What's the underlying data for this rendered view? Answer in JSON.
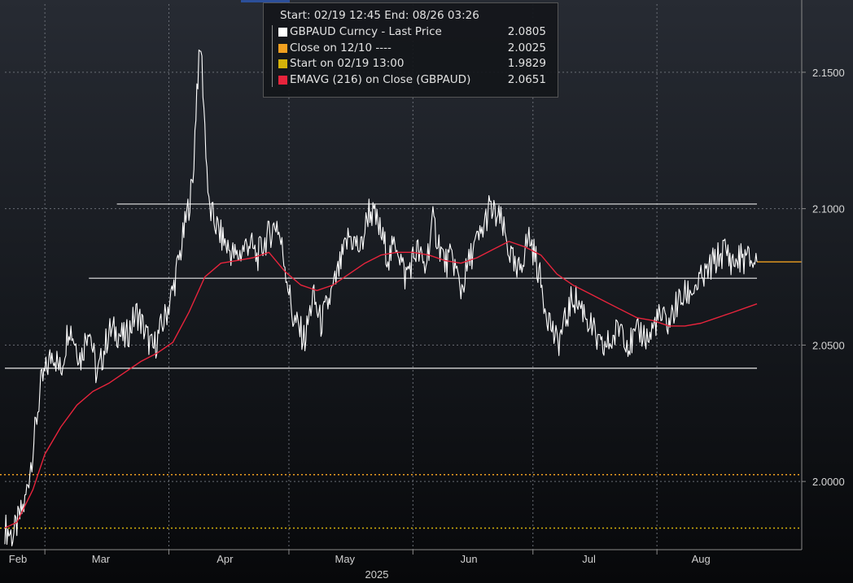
{
  "chart_data": {
    "type": "line",
    "legend": {
      "header": "Start: 02/19 12:45 End: 08/26 03:26",
      "placement": "top-center",
      "entries": [
        {
          "label": "GBPAUD Curncy - Last Price",
          "value": "2.0805",
          "color": "#ffffff"
        },
        {
          "label": "Close on 12/10 ----",
          "value": "2.0025",
          "color": "#f0a020"
        },
        {
          "label": "Start on 02/19 13:00",
          "value": "1.9829",
          "color": "#d4b20a"
        },
        {
          "label": "EMAVG (216)  on Close (GBPAUD)",
          "value": "2.0651",
          "color": "#e8243c"
        }
      ]
    },
    "y_ticks": [
      "2.0000",
      "2.0500",
      "2.1000",
      "2.1500"
    ],
    "ylim": [
      1.975,
      2.175
    ],
    "grid": true,
    "months": [
      "Feb",
      "Mar",
      "Apr",
      "May",
      "Jun",
      "Jul",
      "Aug"
    ],
    "year_label": "2025",
    "x_range": [
      "2025-02-19",
      "2025-08-26"
    ],
    "series": [
      {
        "name": "GBPAUD Curncy - Last Price",
        "color": "#ffffff",
        "x": [
          "2025-02-19",
          "2025-02-21",
          "2025-02-24",
          "2025-02-26",
          "2025-02-28",
          "2025-03-03",
          "2025-03-05",
          "2025-03-07",
          "2025-03-10",
          "2025-03-12",
          "2025-03-14",
          "2025-03-17",
          "2025-03-19",
          "2025-03-21",
          "2025-03-24",
          "2025-03-26",
          "2025-03-28",
          "2025-03-31",
          "2025-04-02",
          "2025-04-04",
          "2025-04-07",
          "2025-04-08",
          "2025-04-09",
          "2025-04-10",
          "2025-04-11",
          "2025-04-14",
          "2025-04-16",
          "2025-04-18",
          "2025-04-21",
          "2025-04-23",
          "2025-04-25",
          "2025-04-28",
          "2025-04-30",
          "2025-05-02",
          "2025-05-05",
          "2025-05-07",
          "2025-05-09",
          "2025-05-12",
          "2025-05-14",
          "2025-05-16",
          "2025-05-19",
          "2025-05-21",
          "2025-05-23",
          "2025-05-26",
          "2025-05-28",
          "2025-05-30",
          "2025-06-02",
          "2025-06-04",
          "2025-06-06",
          "2025-06-09",
          "2025-06-11",
          "2025-06-13",
          "2025-06-16",
          "2025-06-18",
          "2025-06-20",
          "2025-06-23",
          "2025-06-25",
          "2025-06-27",
          "2025-06-30",
          "2025-07-02",
          "2025-07-04",
          "2025-07-07",
          "2025-07-09",
          "2025-07-11",
          "2025-07-14",
          "2025-07-16",
          "2025-07-18",
          "2025-07-21",
          "2025-07-23",
          "2025-07-25",
          "2025-07-28",
          "2025-07-30",
          "2025-08-01",
          "2025-08-04",
          "2025-08-06",
          "2025-08-08",
          "2025-08-11",
          "2025-08-13",
          "2025-08-15",
          "2025-08-18",
          "2025-08-20",
          "2025-08-22",
          "2025-08-26"
        ],
        "values": [
          1.983,
          1.98,
          1.992,
          2.012,
          2.035,
          2.048,
          2.04,
          2.058,
          2.045,
          2.058,
          2.038,
          2.055,
          2.055,
          2.052,
          2.062,
          2.055,
          2.048,
          2.06,
          2.07,
          2.085,
          2.11,
          2.145,
          2.16,
          2.13,
          2.1,
          2.09,
          2.085,
          2.082,
          2.088,
          2.082,
          2.088,
          2.095,
          2.08,
          2.06,
          2.052,
          2.068,
          2.058,
          2.07,
          2.08,
          2.09,
          2.085,
          2.1,
          2.095,
          2.082,
          2.088,
          2.075,
          2.085,
          2.078,
          2.095,
          2.08,
          2.082,
          2.07,
          2.085,
          2.09,
          2.1,
          2.095,
          2.085,
          2.075,
          2.09,
          2.08,
          2.065,
          2.05,
          2.058,
          2.068,
          2.062,
          2.055,
          2.048,
          2.052,
          2.058,
          2.05,
          2.055,
          2.052,
          2.06,
          2.058,
          2.065,
          2.068,
          2.072,
          2.075,
          2.08,
          2.085,
          2.08,
          2.082,
          2.0805
        ]
      },
      {
        "name": "EMAVG (216)  on Close (GBPAUD)",
        "color": "#e8243c",
        "x": [
          "2025-02-19",
          "2025-02-22",
          "2025-02-26",
          "2025-03-01",
          "2025-03-05",
          "2025-03-09",
          "2025-03-13",
          "2025-03-17",
          "2025-03-21",
          "2025-03-25",
          "2025-03-29",
          "2025-04-02",
          "2025-04-06",
          "2025-04-10",
          "2025-04-14",
          "2025-04-18",
          "2025-04-22",
          "2025-04-26",
          "2025-04-30",
          "2025-05-04",
          "2025-05-08",
          "2025-05-12",
          "2025-05-16",
          "2025-05-20",
          "2025-05-24",
          "2025-05-28",
          "2025-06-01",
          "2025-06-05",
          "2025-06-09",
          "2025-06-13",
          "2025-06-17",
          "2025-06-21",
          "2025-06-25",
          "2025-06-29",
          "2025-07-03",
          "2025-07-07",
          "2025-07-11",
          "2025-07-15",
          "2025-07-19",
          "2025-07-23",
          "2025-07-27",
          "2025-07-31",
          "2025-08-04",
          "2025-08-08",
          "2025-08-12",
          "2025-08-16",
          "2025-08-20",
          "2025-08-26"
        ],
        "values": [
          1.983,
          1.985,
          1.997,
          2.01,
          2.02,
          2.028,
          2.033,
          2.036,
          2.04,
          2.044,
          2.047,
          2.051,
          2.062,
          2.075,
          2.08,
          2.081,
          2.082,
          2.084,
          2.077,
          2.072,
          2.07,
          2.072,
          2.076,
          2.08,
          2.083,
          2.084,
          2.084,
          2.083,
          2.081,
          2.08,
          2.082,
          2.085,
          2.088,
          2.086,
          2.083,
          2.076,
          2.072,
          2.069,
          2.066,
          2.063,
          2.06,
          2.059,
          2.057,
          2.057,
          2.058,
          2.06,
          2.062,
          2.0651
        ]
      }
    ],
    "reference_lines": [
      {
        "kind": "close-on",
        "value": 2.0025,
        "style": "dotted",
        "color": "#f0a020"
      },
      {
        "kind": "start-on",
        "value": 1.9829,
        "style": "dotted",
        "color": "#d4b20a"
      },
      {
        "kind": "last-price",
        "value": 2.0805,
        "style": "solid",
        "color": "#f0a020"
      }
    ],
    "trendlines": [
      {
        "value": 2.1017,
        "from": "2025-03-19",
        "to": "2025-08-26"
      },
      {
        "value": 2.0745,
        "from": "2025-03-12",
        "to": "2025-08-26"
      },
      {
        "value": 2.0415,
        "from": "2025-02-19",
        "to": "2025-08-26"
      }
    ]
  }
}
